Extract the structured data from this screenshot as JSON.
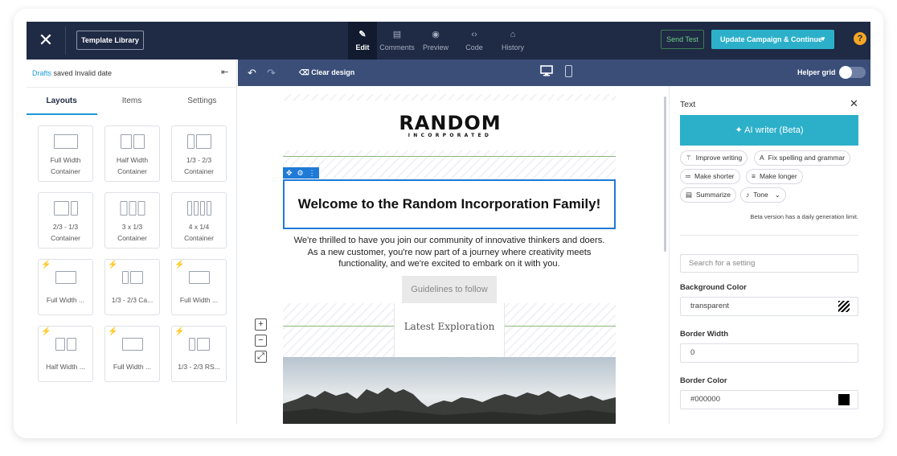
{
  "topbar": {
    "template_library": "Template Library",
    "modes": [
      {
        "label": "Edit",
        "icon": "pencil-icon"
      },
      {
        "label": "Comments",
        "icon": "comment-icon"
      },
      {
        "label": "Preview",
        "icon": "eye-icon"
      },
      {
        "label": "Code",
        "icon": "code-icon"
      },
      {
        "label": "History",
        "icon": "history-icon"
      }
    ],
    "send_test": "Send Test",
    "update_button": "Update Campaign & Continue",
    "help": "?"
  },
  "left_panel": {
    "drafts_link": "Drafts",
    "drafts_status": " saved Invalid date",
    "tabs": [
      "Layouts",
      "Items",
      "Settings"
    ],
    "active_tab": "Layouts",
    "layouts": [
      {
        "label": "Full Width\nContainer"
      },
      {
        "label": "Half Width\nContainer"
      },
      {
        "label": "1/3 - 2/3\nContainer"
      },
      {
        "label": "2/3 - 1/3\nContainer"
      },
      {
        "label": "3 x 1/3\nContainer"
      },
      {
        "label": "4 x 1/4\nContainer"
      },
      {
        "label": "Full Width ..."
      },
      {
        "label": "1/3 - 2/3 Ca..."
      },
      {
        "label": "Full Width ..."
      },
      {
        "label": "Half Width ..."
      },
      {
        "label": "Full Width ..."
      },
      {
        "label": "1/3 - 2/3 RS..."
      }
    ]
  },
  "canvas_toolbar": {
    "clear_design": "Clear design",
    "helper_grid": "Helper grid"
  },
  "email": {
    "logo_big": "RANDOM",
    "logo_small": "INCORPORATED",
    "hero_title": "Welcome to the Random Incorporation Family!",
    "body": "We're thrilled to have you join our community of innovative thinkers and doers. As a new customer, you're now part of a journey where creativity meets functionality, and we're excited to embark on it with you.",
    "guide_button": "Guidelines to follow",
    "section_title": "Latest Exploration"
  },
  "zoom": {
    "in": "+",
    "out": "−",
    "fit": "⤢"
  },
  "right_panel": {
    "title": "Text",
    "ai_writer": "AI writer (Beta)",
    "chips": [
      {
        "label": "Improve writing",
        "icon": "wand-icon"
      },
      {
        "label": "Fix spelling and grammar",
        "icon": "spellcheck-icon"
      },
      {
        "label": "Make shorter",
        "icon": "shorter-icon"
      },
      {
        "label": "Make longer",
        "icon": "longer-icon"
      },
      {
        "label": "Summarize",
        "icon": "summarize-icon"
      },
      {
        "label": "Tone",
        "icon": "tone-icon"
      }
    ],
    "beta_note": "Beta version has a daily generation limit.",
    "search_placeholder": "Search for a setting",
    "background_color_label": "Background Color",
    "background_color_value": "transparent",
    "border_width_label": "Border Width",
    "border_width_value": "0",
    "border_color_label": "Border Color",
    "border_color_value": "#000000"
  },
  "colors": {
    "topbar": "#1f2a44",
    "accent": "#2cb0c9",
    "link": "#1a9ad6",
    "selection": "#1f7ad6"
  }
}
